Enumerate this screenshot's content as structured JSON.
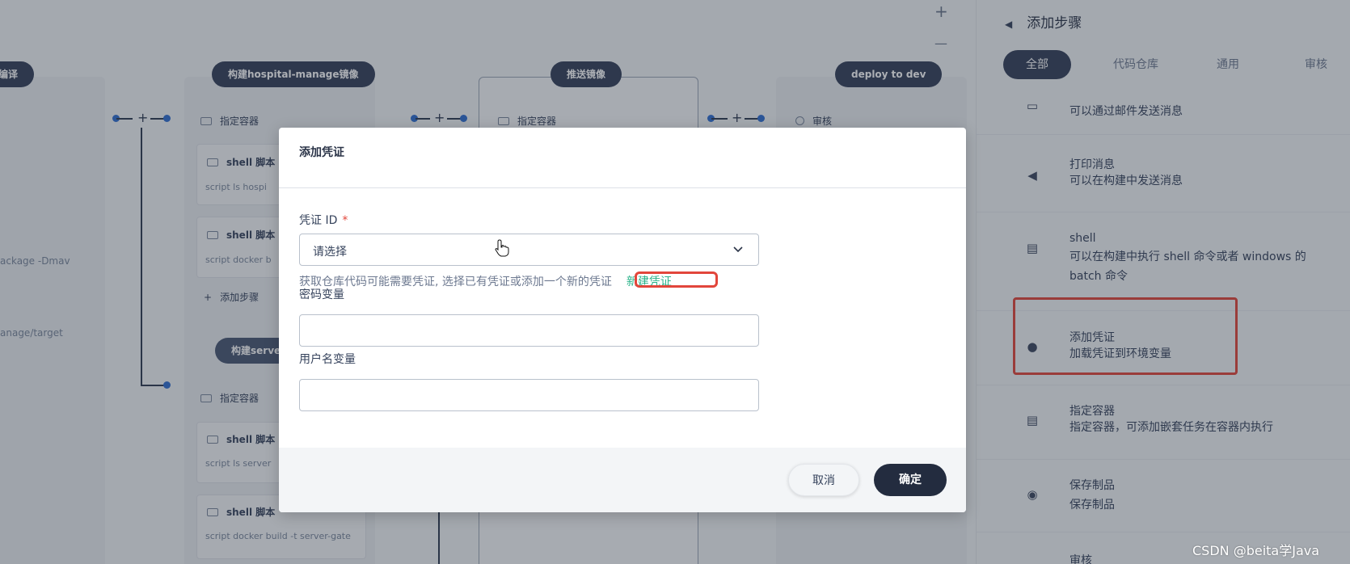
{
  "canvas": {
    "stages": [
      {
        "title": "编译"
      },
      {
        "title": "构建hospital-manage镜像"
      },
      {
        "title": "推送镜像"
      },
      {
        "title": "deploy to dev"
      },
      {
        "title": "构建server"
      }
    ],
    "steps": {
      "container_1": "指定容器",
      "shell_1": "shell 脚本",
      "shell_1_script": "script   ls hospi",
      "shell_2": "shell 脚本",
      "shell_2_script": "script   docker  b",
      "add_step": "添加步骤",
      "container_2": "指定容器",
      "review": "审核",
      "container_3": "指定容器",
      "shell_3": "shell 脚本",
      "shell_3_script": "script   ls server",
      "shell_4": "shell 脚本",
      "shell_4_script": "script   docker build -t server-gate"
    },
    "left_texts": [
      "ackage -Dmav",
      "anage/target"
    ],
    "zoom_in": "+",
    "zoom_out": "—"
  },
  "panel": {
    "title": "添加步骤",
    "back_icon": "back-arrow-icon",
    "tabs": [
      "全部",
      "代码仓库",
      "通用",
      "审核"
    ],
    "active_tab": "全部",
    "items": [
      {
        "name": "",
        "desc": "可以通过邮件发送消息",
        "icon": "mail-icon"
      },
      {
        "name": "打印消息",
        "desc": "可以在构建中发送消息",
        "icon": "megaphone-icon"
      },
      {
        "name": "shell",
        "desc": "可以在构建中执行 shell 命令或者 windows 的 batch 命令",
        "icon": "terminal-icon"
      },
      {
        "name": "添加凭证",
        "desc": "加载凭证到环境变量",
        "icon": "key-icon"
      },
      {
        "name": "指定容器",
        "desc": "指定容器，可添加嵌套任务在容器内执行",
        "icon": "container-icon"
      },
      {
        "name": "保存制品",
        "desc": "保存制品",
        "icon": "artifact-icon"
      },
      {
        "name": "审核",
        "desc": "",
        "icon": "review-icon"
      }
    ]
  },
  "modal": {
    "title": "添加凭证",
    "credential_label": "凭证 ID",
    "required_mark": "*",
    "select_placeholder": "请选择",
    "hint": "获取仓库代码可能需要凭证, 选择已有凭证或添加一个新的凭证",
    "new_credential_link": "新建凭证",
    "password_label": "密码变量",
    "password_value": "",
    "username_label": "用户名变量",
    "username_value": "",
    "cancel": "取消",
    "confirm": "确定"
  },
  "watermark": "CSDN @beita学Java",
  "colors": {
    "primary_dark": "#232c3f",
    "stage_title": "#34405a",
    "link_green": "#2bb38a",
    "highlight_red": "#e2463b",
    "node_blue": "#2f6ed0"
  }
}
